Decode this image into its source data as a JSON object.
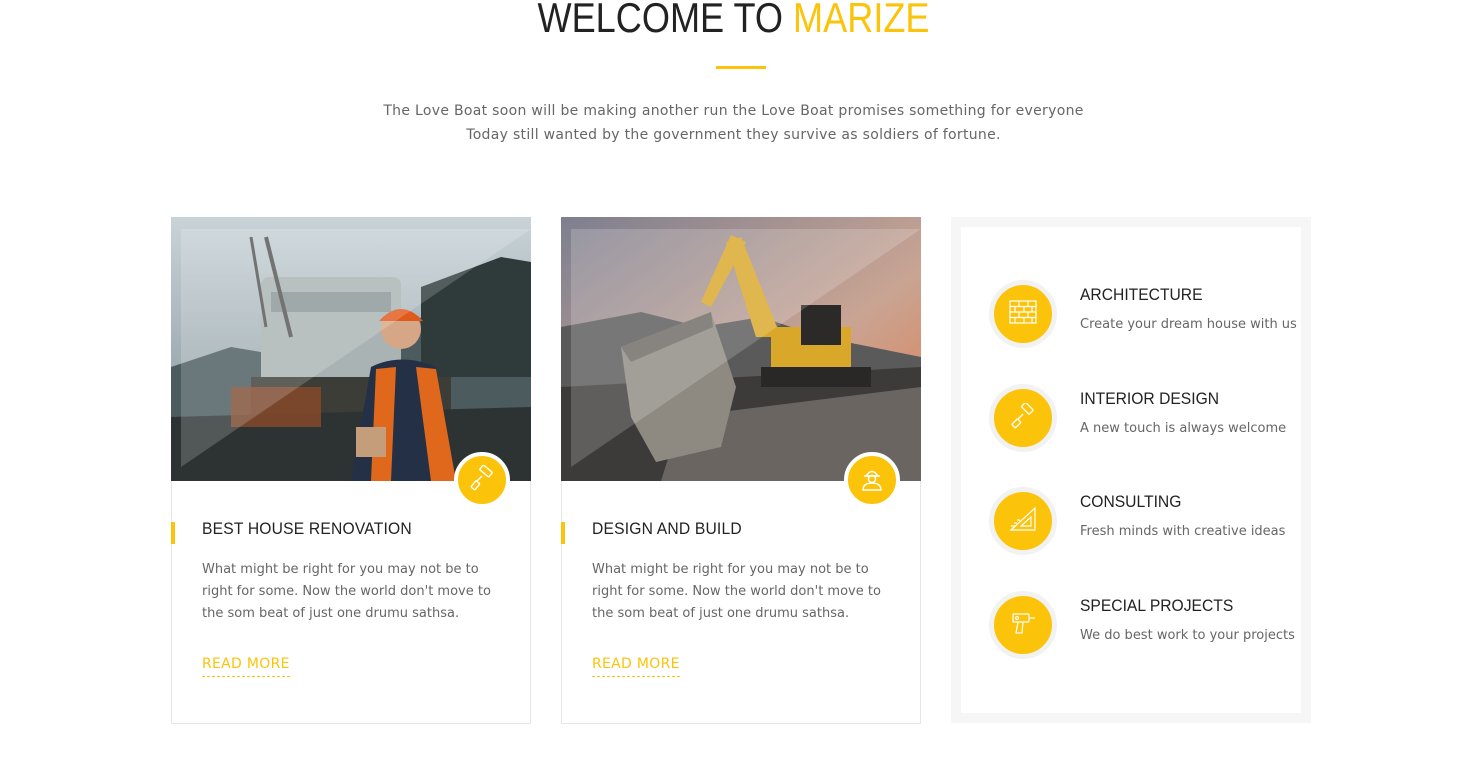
{
  "header": {
    "title_main": "WELCOME TO",
    "title_accent": "MARIZE",
    "intro_line1": "The Love Boat soon will be making another run the Love Boat promises something for everyone",
    "intro_line2": "Today still wanted by the government they survive as soldiers of fortune."
  },
  "cards": [
    {
      "title": "BEST HOUSE RENOVATION",
      "description": "What might be right for you may not be to right for some. Now the world don't move to the som beat of just one drumu sathsa.",
      "link": "READ MORE",
      "icon": "paint-roller-icon"
    },
    {
      "title": "DESIGN AND BUILD",
      "description": "What might be right for you may not be to right for some. Now the world don't move to the som beat of just one drumu sathsa.",
      "link": "READ MORE",
      "icon": "worker-icon"
    }
  ],
  "services": [
    {
      "title": "ARCHITECTURE",
      "subtitle": "Create your dream house with us",
      "icon": "brick-wall-icon"
    },
    {
      "title": "INTERIOR DESIGN",
      "subtitle": "A new touch is always welcome",
      "icon": "paint-roller-icon"
    },
    {
      "title": "CONSULTING",
      "subtitle": "Fresh minds with creative ideas",
      "icon": "set-square-icon"
    },
    {
      "title": "SPECIAL PROJECTS",
      "subtitle": "We do best work to your projects",
      "icon": "drill-icon"
    }
  ],
  "colors": {
    "accent": "#fcc30b",
    "heading": "#222222",
    "text": "#666666"
  }
}
